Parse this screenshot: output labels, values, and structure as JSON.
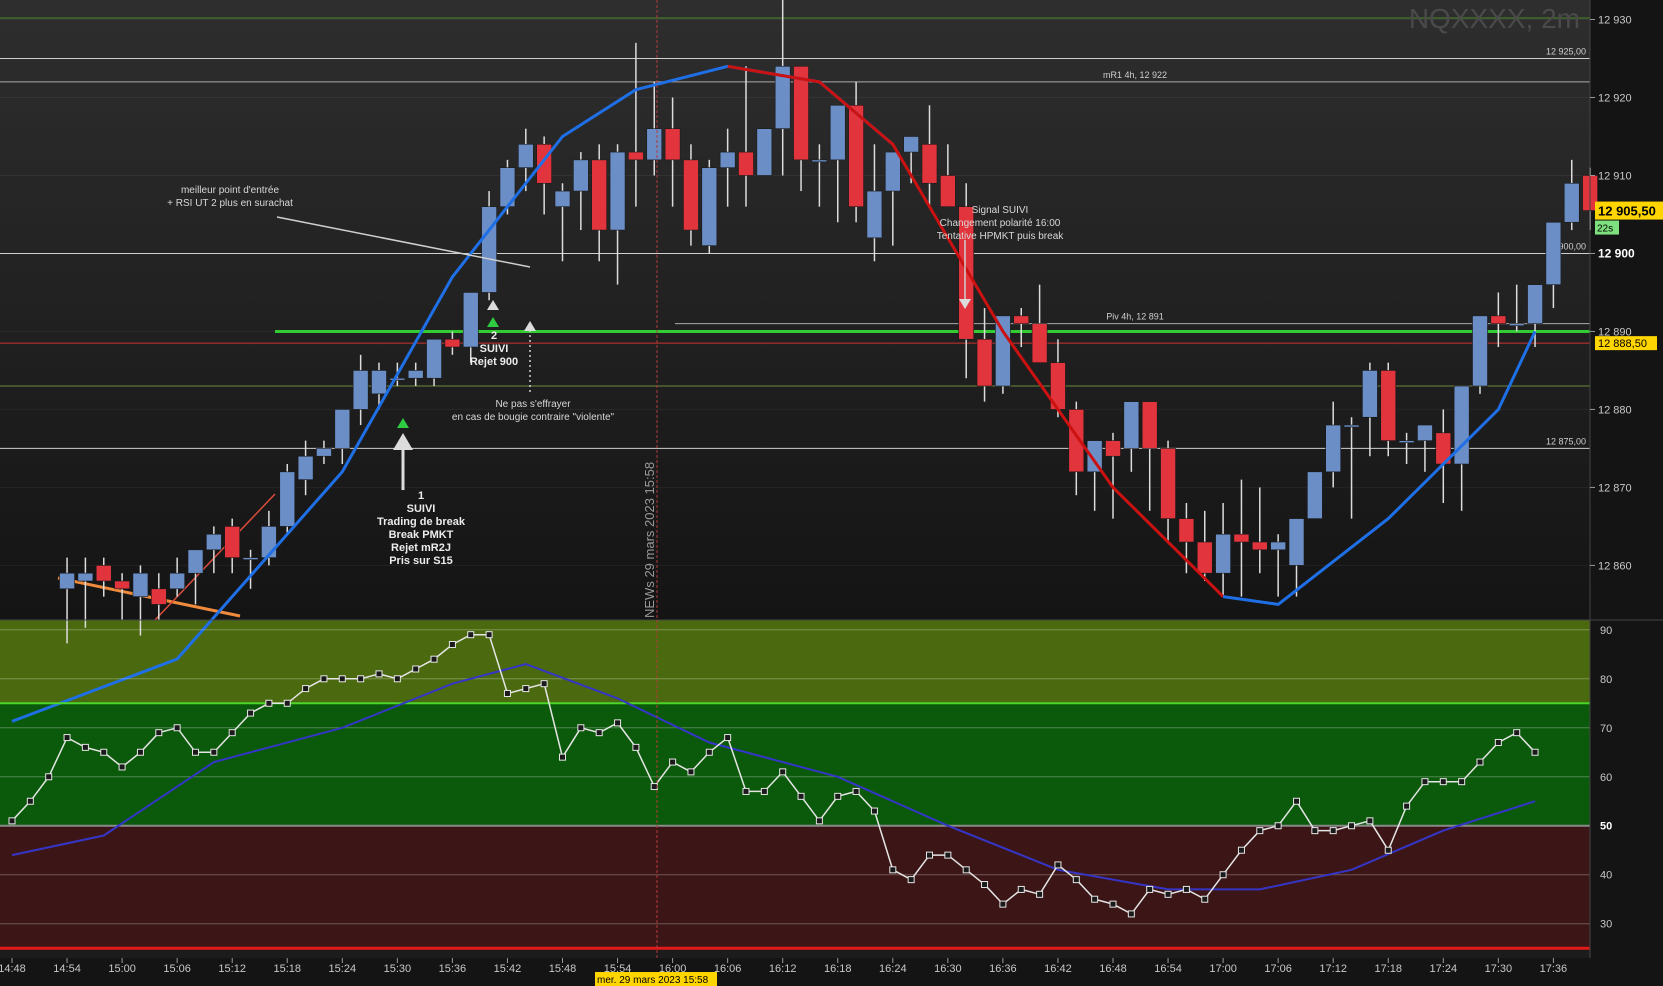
{
  "chart_data": [
    {
      "type": "candlestick",
      "title": "NQXXXX, 2m",
      "price_axis": {
        "ticks": [
          "12 930",
          "12 920",
          "12 910",
          "12 900",
          "12 890",
          "12 880",
          "12 870",
          "12 860"
        ],
        "ylim": [
          12853,
          12932.5
        ]
      },
      "time_axis": {
        "ticks": [
          "14:48",
          "14:54",
          "15:00",
          "15:06",
          "15:12",
          "15:18",
          "15:24",
          "15:30",
          "15:36",
          "15:42",
          "15:48",
          "15:54",
          "16:00",
          "16:06",
          "16:12",
          "16:18",
          "16:24",
          "16:30",
          "16:36",
          "16:42",
          "16:48",
          "16:54",
          "17:00",
          "17:06",
          "17:12",
          "17:18",
          "17:24",
          "17:30",
          "17:36"
        ],
        "bar_minutes": 2,
        "start": "14:48"
      },
      "candles": [
        [
          12857,
          12861,
          12850,
          12859
        ],
        [
          12858,
          12861,
          12852,
          12859
        ],
        [
          12860,
          12861,
          12856,
          12858
        ],
        [
          12858,
          12859,
          12853,
          12857
        ],
        [
          12856,
          12860,
          12851,
          12859
        ],
        [
          12857,
          12859,
          12853,
          12855
        ],
        [
          12857,
          12861,
          12856,
          12859
        ],
        [
          12859,
          12862,
          12855,
          12862
        ],
        [
          12862,
          12865,
          12859,
          12864
        ],
        [
          12865,
          12866,
          12859,
          12861
        ],
        [
          12861,
          12862,
          12857,
          12861
        ],
        [
          12861,
          12867,
          12860,
          12865
        ],
        [
          12865,
          12873,
          12864,
          12872
        ],
        [
          12871,
          12876,
          12869,
          12874
        ],
        [
          12874,
          12876,
          12873,
          12875
        ],
        [
          12875,
          12880,
          12873,
          12880
        ],
        [
          12880,
          12887,
          12878,
          12885
        ],
        [
          12882,
          12886,
          12880,
          12885
        ],
        [
          12884,
          12886,
          12883,
          12884
        ],
        [
          12884,
          12886,
          12883,
          12885
        ],
        [
          12884,
          12889,
          12883,
          12889
        ],
        [
          12889,
          12890,
          12887,
          12888
        ],
        [
          12888,
          12892,
          12886,
          12895
        ],
        [
          12895,
          12908,
          12894,
          12906
        ],
        [
          12906,
          12912,
          12905,
          12911
        ],
        [
          12911,
          12916,
          12908,
          12914
        ],
        [
          12914,
          12915,
          12905,
          12909
        ],
        [
          12906,
          12909,
          12899,
          12908
        ],
        [
          12908,
          12913,
          12903,
          12912
        ],
        [
          12912,
          12914,
          12899,
          12903
        ],
        [
          12903,
          12914,
          12896,
          12913
        ],
        [
          12913,
          12927,
          12906,
          12912
        ],
        [
          12912,
          12922,
          12910,
          12916
        ],
        [
          12916,
          12920,
          12906,
          12912
        ],
        [
          12912,
          12914,
          12901,
          12903
        ],
        [
          12901,
          12912,
          12900,
          12911
        ],
        [
          12911,
          12916,
          12906,
          12913
        ],
        [
          12913,
          12924,
          12906,
          12910
        ],
        [
          12910,
          12916,
          12910,
          12916
        ],
        [
          12916,
          12933,
          12910,
          12924
        ],
        [
          12924,
          12924,
          12908,
          12912
        ],
        [
          12912,
          12914,
          12906,
          12912
        ],
        [
          12912,
          12919,
          12904,
          12919
        ],
        [
          12919,
          12922,
          12904,
          12906
        ],
        [
          12902,
          12914,
          12899,
          12908
        ],
        [
          12908,
          12912,
          12901,
          12913
        ],
        [
          12913,
          12914,
          12909,
          12915
        ],
        [
          12914,
          12919,
          12906,
          12909
        ],
        [
          12910,
          12914,
          12906,
          12906
        ],
        [
          12906,
          12909,
          12884,
          12889
        ],
        [
          12889,
          12893,
          12881,
          12883
        ],
        [
          12883,
          12890,
          12882,
          12892
        ],
        [
          12892,
          12893,
          12888,
          12891
        ],
        [
          12891,
          12896,
          12886,
          12886
        ],
        [
          12886,
          12889,
          12879,
          12880
        ],
        [
          12880,
          12881,
          12869,
          12872
        ],
        [
          12872,
          12876,
          12867,
          12876
        ],
        [
          12876,
          12877,
          12866,
          12874
        ],
        [
          12875,
          12876,
          12872,
          12881
        ],
        [
          12881,
          12881,
          12867,
          12875
        ],
        [
          12875,
          12876,
          12863,
          12866
        ],
        [
          12866,
          12868,
          12859,
          12863
        ],
        [
          12863,
          12867,
          12858,
          12859
        ],
        [
          12859,
          12868,
          12856,
          12864
        ],
        [
          12864,
          12871,
          12856,
          12863
        ],
        [
          12863,
          12870,
          12859,
          12862
        ],
        [
          12862,
          12864,
          12856,
          12863
        ],
        [
          12860,
          12866,
          12856,
          12866
        ],
        [
          12866,
          12871,
          12866,
          12872
        ],
        [
          12872,
          12881,
          12870,
          12878
        ],
        [
          12878,
          12879,
          12866,
          12878
        ],
        [
          12879,
          12886,
          12874,
          12885
        ],
        [
          12885,
          12886,
          12874,
          12876
        ],
        [
          12876,
          12877,
          12873,
          12876
        ],
        [
          12876,
          12878,
          12872,
          12878
        ],
        [
          12877,
          12880,
          12868,
          12873
        ],
        [
          12873,
          12881,
          12867,
          12883
        ],
        [
          12883,
          12892,
          12882,
          12892
        ],
        [
          12892,
          12895,
          12888,
          12891
        ],
        [
          12891,
          12896,
          12890,
          12891
        ],
        [
          12891,
          12896,
          12888,
          12896
        ],
        [
          12896,
          12903,
          12893,
          12904
        ],
        [
          12904,
          12912,
          12903,
          12909
        ],
        [
          12910,
          12911,
          12903,
          12905.5
        ]
      ],
      "ma_line_samples": [
        {
          "t": "14:48",
          "v": 12840
        },
        {
          "t": "15:06",
          "v": 12848
        },
        {
          "t": "15:24",
          "v": 12872
        },
        {
          "t": "15:36",
          "v": 12897
        },
        {
          "t": "15:48",
          "v": 12915
        },
        {
          "t": "15:56",
          "v": 12921
        },
        {
          "t": "16:06",
          "v": 12924
        },
        {
          "t": "16:16",
          "v": 12922
        },
        {
          "t": "16:24",
          "v": 12914
        },
        {
          "t": "16:36",
          "v": 12890
        },
        {
          "t": "16:48",
          "v": 12870
        },
        {
          "t": "17:00",
          "v": 12856
        },
        {
          "t": "17:06",
          "v": 12855
        },
        {
          "t": "17:18",
          "v": 12866
        },
        {
          "t": "17:30",
          "v": 12880
        },
        {
          "t": "17:34",
          "v": 12890
        }
      ],
      "horizontal_lines": [
        {
          "price": 12925,
          "label": "12 925,00",
          "color": "#cfcfcf"
        },
        {
          "price": 12922,
          "label": "mR1 4h, 12 922",
          "color": "#aaaaaa"
        },
        {
          "price": 12900,
          "label": "12 900,00",
          "color": "#cfcfcf"
        },
        {
          "price": 12891,
          "label": "Piv 4h, 12 891",
          "color": "#aaaaaa"
        },
        {
          "price": 12890,
          "label": "",
          "color": "#33cc33"
        },
        {
          "price": 12888.5,
          "label": "",
          "color": "#cc3333"
        },
        {
          "price": 12875,
          "label": "12 875,00",
          "color": "#cfcfcf"
        },
        {
          "price": 12883,
          "label": "",
          "color": "#6c8a3a"
        }
      ],
      "last_price_tag": "12 905,50",
      "countdown_tag": "22s",
      "level_tag": "12 888,50",
      "bold_tick": "12 900",
      "news": {
        "vertical_label": "NEWs 29 mars 2023 15:58",
        "axis_tag": "mer. 29 mars 2023 15:58"
      },
      "annotations": [
        {
          "lines": [
            "meilleur point d'entrée",
            "+ RSI UT 2 plus en surachat"
          ],
          "bold": false
        },
        {
          "lines": [
            "1",
            "SUIVI",
            "Trading de break",
            "Break PMKT",
            "Rejet mR2J",
            "Pris sur S15"
          ],
          "bold": true
        },
        {
          "lines": [
            "2",
            "SUIVI",
            "Rejet 900"
          ],
          "bold": true
        },
        {
          "lines": [
            "Ne pas s'effrayer",
            "en cas de bougie contraire \"violente\""
          ],
          "bold": false
        },
        {
          "lines": [
            "Signal SUIVI",
            "Changement polarité 16:00",
            "Tentative HPMKT puis break"
          ],
          "bold": false
        }
      ]
    },
    {
      "type": "line",
      "name": "RSI panel",
      "yticks": [
        "90",
        "80",
        "70",
        "60",
        "50",
        "40",
        "30"
      ],
      "ylim": [
        23,
        92
      ],
      "zones": {
        "overbought": 75,
        "mid": 50,
        "oversold": 25
      },
      "rsi_values": [
        51,
        55,
        60,
        68,
        66,
        65,
        62,
        65,
        69,
        70,
        65,
        65,
        69,
        73,
        75,
        75,
        78,
        80,
        80,
        80,
        81,
        80,
        82,
        84,
        87,
        89,
        89,
        77,
        78,
        79,
        64,
        70,
        69,
        71,
        66,
        58,
        63,
        61,
        65,
        68,
        57,
        57,
        61,
        56,
        51,
        56,
        57,
        53,
        41,
        39,
        44,
        44,
        41,
        38,
        34,
        37,
        36,
        42,
        39,
        35,
        34,
        32,
        37,
        36,
        37,
        35,
        40,
        45,
        49,
        50,
        55,
        49,
        49,
        50,
        51,
        45,
        54,
        59,
        59,
        59,
        63,
        67,
        69,
        65
      ],
      "signal_samples": [
        {
          "t": "14:48",
          "v": 44
        },
        {
          "t": "14:58",
          "v": 48
        },
        {
          "t": "15:10",
          "v": 63
        },
        {
          "t": "15:24",
          "v": 70
        },
        {
          "t": "15:36",
          "v": 79
        },
        {
          "t": "15:44",
          "v": 83
        },
        {
          "t": "15:54",
          "v": 76
        },
        {
          "t": "16:04",
          "v": 67
        },
        {
          "t": "16:18",
          "v": 60
        },
        {
          "t": "16:30",
          "v": 50
        },
        {
          "t": "16:42",
          "v": 41
        },
        {
          "t": "16:54",
          "v": 37
        },
        {
          "t": "17:04",
          "v": 37
        },
        {
          "t": "17:14",
          "v": 41
        },
        {
          "t": "17:24",
          "v": 49
        },
        {
          "t": "17:34",
          "v": 55
        }
      ]
    }
  ],
  "colors": {
    "bull": "#6b8ec7",
    "bear": "#e2343c",
    "ma_up": "#1f6fe6",
    "ma_down": "#cc1111",
    "rsi_line": "#e5e5e5",
    "rsi_signal": "#3535c8",
    "zone_overbought": "#4b6a0f",
    "zone_mid": "#0b5a0b",
    "zone_oversold": "#3c1616",
    "price_tag": "#ffd500",
    "countdown_tag": "#7ee07e"
  }
}
